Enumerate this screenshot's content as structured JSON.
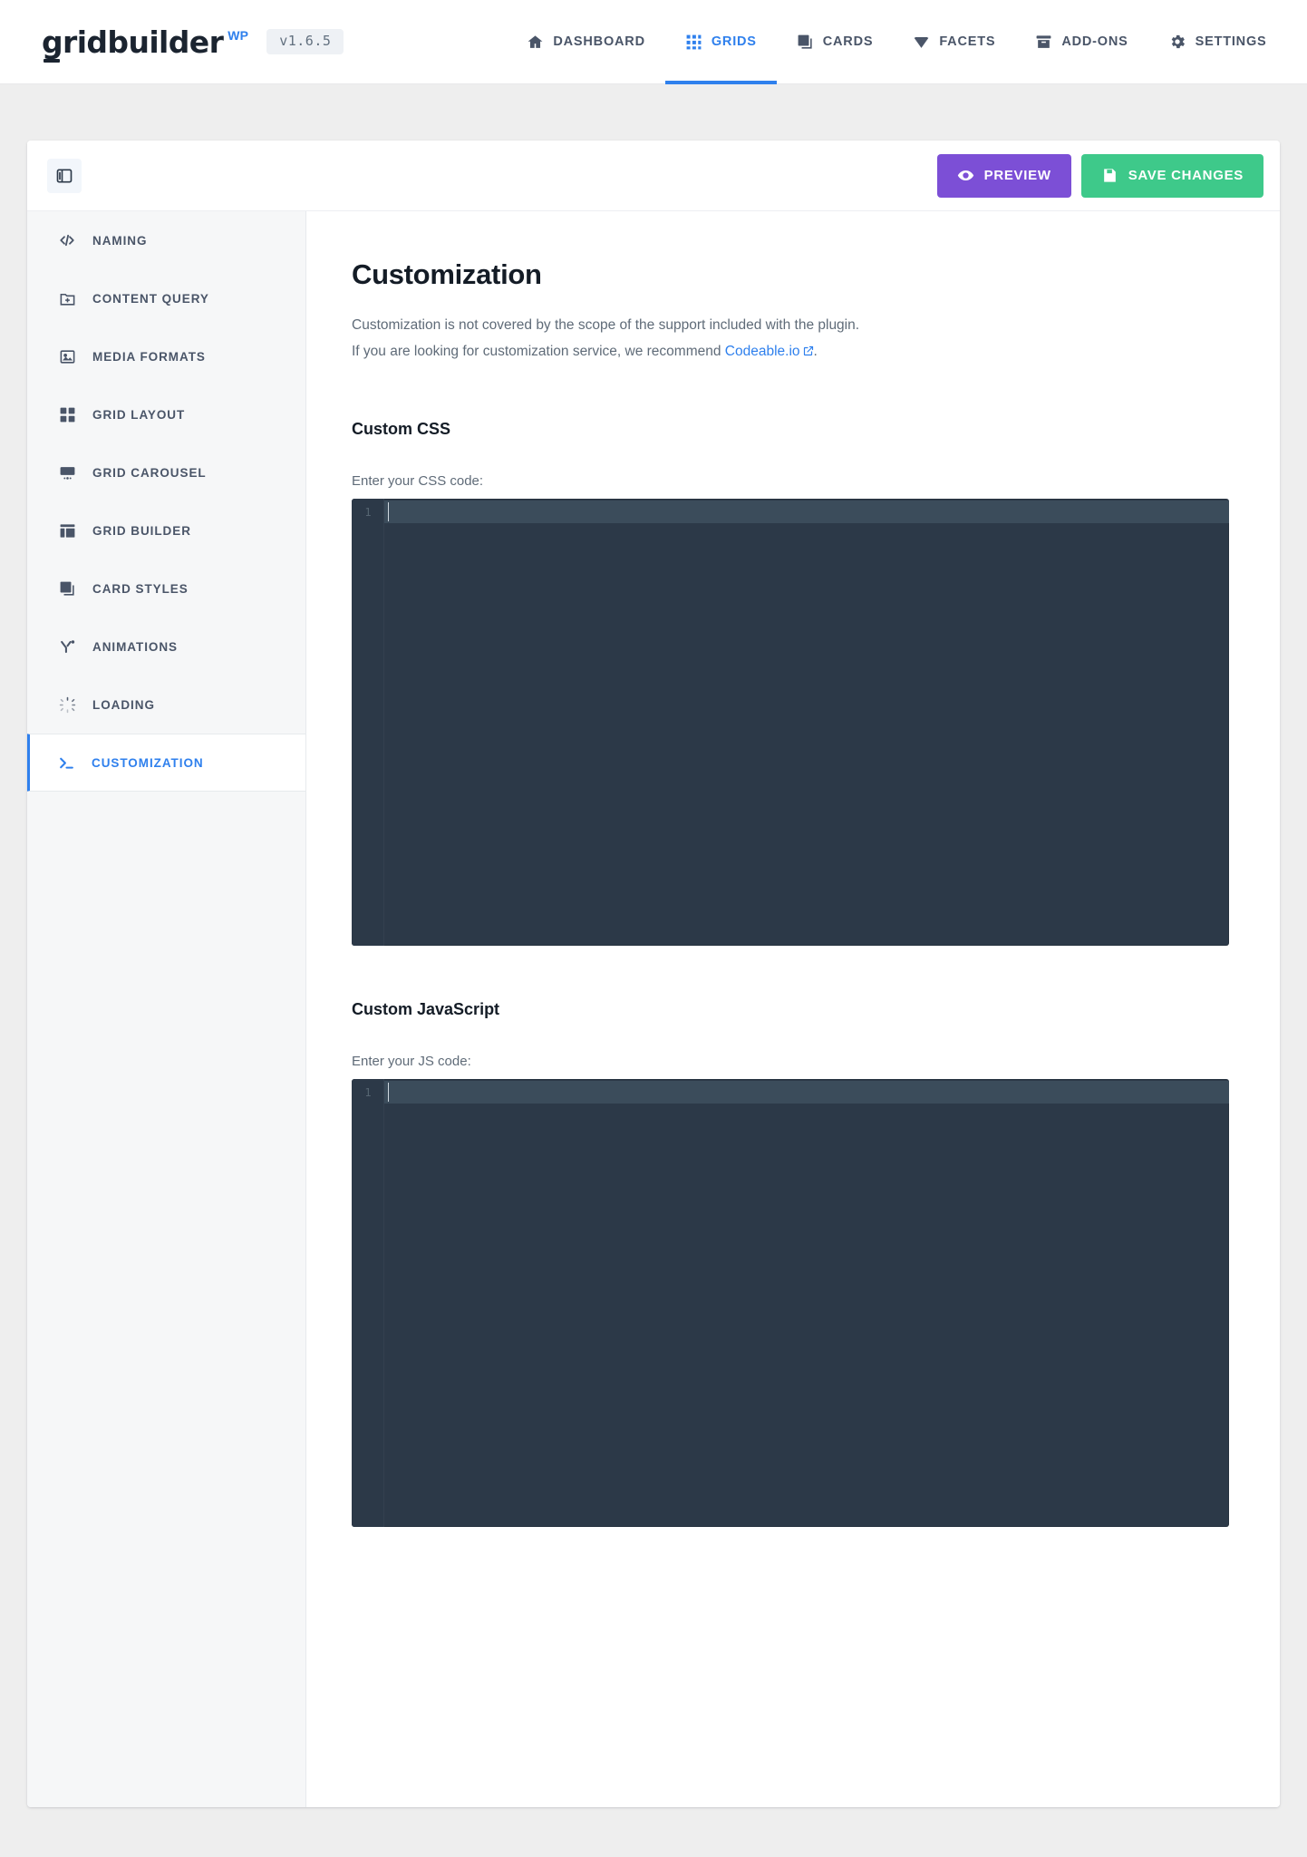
{
  "header": {
    "logo_text": "gridbuilder",
    "logo_suffix": "WP",
    "version": "v1.6.5",
    "nav": [
      {
        "label": "DASHBOARD",
        "icon": "home-icon",
        "active": false
      },
      {
        "label": "GRIDS",
        "icon": "grid-dots-icon",
        "active": true
      },
      {
        "label": "CARDS",
        "icon": "cards-icon",
        "active": false
      },
      {
        "label": "FACETS",
        "icon": "diamond-icon",
        "active": false
      },
      {
        "label": "ADD-ONS",
        "icon": "box-icon",
        "active": false
      },
      {
        "label": "SETTINGS",
        "icon": "gear-icon",
        "active": false
      }
    ]
  },
  "toolbar": {
    "panel_toggle_icon": "sidebar-toggle-icon",
    "preview_label": "PREVIEW",
    "preview_icon": "eye-icon",
    "save_label": "SAVE CHANGES",
    "save_icon": "floppy-disk-icon"
  },
  "sidebar": {
    "items": [
      {
        "label": "NAMING",
        "icon": "code-tags-icon",
        "active": false
      },
      {
        "label": "CONTENT QUERY",
        "icon": "folder-plus-icon",
        "active": false
      },
      {
        "label": "MEDIA FORMATS",
        "icon": "image-icon",
        "active": false
      },
      {
        "label": "GRID LAYOUT",
        "icon": "grid-squares-icon",
        "active": false
      },
      {
        "label": "GRID CAROUSEL",
        "icon": "carousel-icon",
        "active": false
      },
      {
        "label": "GRID BUILDER",
        "icon": "layout-builder-icon",
        "active": false
      },
      {
        "label": "CARD STYLES",
        "icon": "cards-icon",
        "active": false
      },
      {
        "label": "ANIMATIONS",
        "icon": "animation-icon",
        "active": false
      },
      {
        "label": "LOADING",
        "icon": "spinner-icon",
        "active": false
      },
      {
        "label": "CUSTOMIZATION",
        "icon": "terminal-prompt-icon",
        "active": true
      }
    ]
  },
  "main": {
    "title": "Customization",
    "intro_line1": "Customization is not covered by the scope of the support included with the plugin.",
    "intro_line2_before": "If you are looking for customization service, we recommend ",
    "intro_link": "Codeable.io",
    "intro_line2_after": ".",
    "css_section": {
      "heading": "Custom CSS",
      "field_label": "Enter your CSS code:",
      "line_number": "1",
      "value": ""
    },
    "js_section": {
      "heading": "Custom JavaScript",
      "field_label": "Enter your JS code:",
      "line_number": "1",
      "value": ""
    }
  },
  "colors": {
    "accent_blue": "#2f80ed",
    "preview_purple": "#7c4fd6",
    "save_green": "#3ec98a",
    "editor_bg": "#2c3948",
    "text_dark": "#141c26",
    "text_muted": "#5f6b78"
  }
}
